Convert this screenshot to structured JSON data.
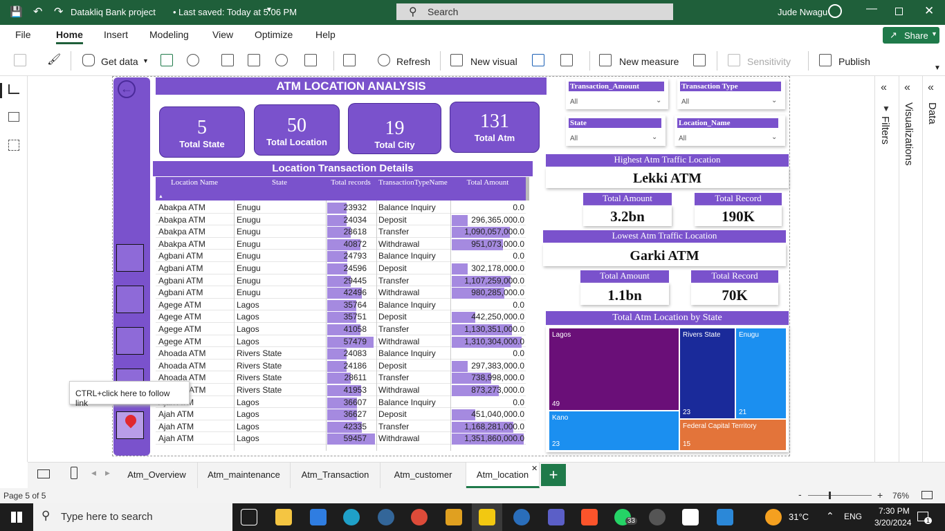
{
  "titlebar": {
    "doc_title": "Datakliq Bank project",
    "saved": "Last saved: Today at 5:06 PM",
    "search_placeholder": "Search",
    "user": "Jude Nwagu"
  },
  "menu": {
    "items": [
      "File",
      "Home",
      "Insert",
      "Modeling",
      "View",
      "Optimize",
      "Help"
    ],
    "active": "Home",
    "share": "Share"
  },
  "ribbon": {
    "get_data": "Get data",
    "refresh": "Refresh",
    "new_visual": "New visual",
    "new_measure": "New measure",
    "sensitivity": "Sensitivity",
    "publish": "Publish"
  },
  "report": {
    "title": "ATM LOCATION ANALYSIS",
    "kpis": [
      {
        "value": "5",
        "label": "Total State"
      },
      {
        "value": "50",
        "label": "Total Location"
      },
      {
        "value": "19",
        "label": "Total City"
      },
      {
        "value": "131",
        "label": "Total Atm"
      }
    ],
    "table": {
      "title": "Location Transaction Details",
      "columns": [
        "Location Name",
        "State",
        "Total records",
        "TransactionTypeName",
        "Total Amount"
      ],
      "rows": [
        [
          "Abakpa ATM",
          "Enugu",
          "23932",
          "Balance Inquiry",
          "0.0",
          0.4,
          0.0
        ],
        [
          "Abakpa ATM",
          "Enugu",
          "24034",
          "Deposit",
          "296,365,000.0",
          0.4,
          0.22
        ],
        [
          "Abakpa ATM",
          "Enugu",
          "28618",
          "Transfer",
          "1,090,057,000.0",
          0.48,
          0.81
        ],
        [
          "Abakpa ATM",
          "Enugu",
          "40872",
          "Withdrawal",
          "951,073,000.0",
          0.68,
          0.71
        ],
        [
          "Agbani ATM",
          "Enugu",
          "24793",
          "Balance Inquiry",
          "0.0",
          0.41,
          0.0
        ],
        [
          "Agbani ATM",
          "Enugu",
          "24596",
          "Deposit",
          "302,178,000.0",
          0.41,
          0.22
        ],
        [
          "Agbani ATM",
          "Enugu",
          "29445",
          "Transfer",
          "1,107,259,000.0",
          0.49,
          0.82
        ],
        [
          "Agbani ATM",
          "Enugu",
          "42496",
          "Withdrawal",
          "980,285,000.0",
          0.71,
          0.73
        ],
        [
          "Agege ATM",
          "Lagos",
          "35764",
          "Balance Inquiry",
          "0.0",
          0.6,
          0.0
        ],
        [
          "Agege ATM",
          "Lagos",
          "35751",
          "Deposit",
          "442,250,000.0",
          0.6,
          0.33
        ],
        [
          "Agege ATM",
          "Lagos",
          "41058",
          "Transfer",
          "1,130,351,000.0",
          0.69,
          0.84
        ],
        [
          "Agege ATM",
          "Lagos",
          "57479",
          "Withdrawal",
          "1,310,304,000.0",
          0.96,
          0.97
        ],
        [
          "Ahoada ATM",
          "Rivers State",
          "24083",
          "Balance Inquiry",
          "0.0",
          0.4,
          0.0
        ],
        [
          "Ahoada ATM",
          "Rivers State",
          "24186",
          "Deposit",
          "297,383,000.0",
          0.4,
          0.22
        ],
        [
          "Ahoada ATM",
          "Rivers State",
          "28611",
          "Transfer",
          "738,998,000.0",
          0.48,
          0.55
        ],
        [
          "Ahoada ATM",
          "Rivers State",
          "41953",
          "Withdrawal",
          "873,273,000.0",
          0.7,
          0.65
        ],
        [
          "Ajah ATM",
          "Lagos",
          "36607",
          "Balance Inquiry",
          "0.0",
          0.61,
          0.0
        ],
        [
          "Ajah ATM",
          "Lagos",
          "36627",
          "Deposit",
          "451,040,000.0",
          0.61,
          0.33
        ],
        [
          "Ajah ATM",
          "Lagos",
          "42335",
          "Transfer",
          "1,168,281,000.0",
          0.71,
          0.86
        ],
        [
          "Ajah ATM",
          "Lagos",
          "59457",
          "Withdrawal",
          "1,351,860,000.0",
          0.99,
          1.0
        ]
      ]
    },
    "slicers": [
      {
        "title": "Transaction_Amount",
        "value": "All"
      },
      {
        "title": "Transaction Type",
        "value": "All"
      },
      {
        "title": "State",
        "value": "All"
      },
      {
        "title": "Location_Name",
        "value": "All"
      }
    ],
    "highest": {
      "header": "Highest Atm Traffic Location",
      "name": "Lekki ATM",
      "amount_label": "Total Amount",
      "amount": "3.2bn",
      "record_label": "Total Record",
      "record": "190K"
    },
    "lowest": {
      "header": "Lowest Atm Traffic Location",
      "name": "Garki ATM",
      "amount_label": "Total Amount",
      "amount": "1.1bn",
      "record_label": "Total Record",
      "record": "70K"
    },
    "treemap": {
      "title": "Total Atm Location by State",
      "items": [
        {
          "name": "Lagos",
          "value": "49",
          "color": "#6a0f78"
        },
        {
          "name": "Rivers State",
          "value": "23",
          "color": "#1a2a9a"
        },
        {
          "name": "Enugu",
          "value": "21",
          "color": "#1b8ff0"
        },
        {
          "name": "Kano",
          "value": "23",
          "color": "#1b8ff0"
        },
        {
          "name": "Federal Capital Territory",
          "value": "15",
          "color": "#e3743a"
        }
      ]
    },
    "tooltip": "CTRL+click here to follow link"
  },
  "panes": {
    "filters": "Filters",
    "visualizations": "Visualizations",
    "data": "Data"
  },
  "pages": {
    "tabs": [
      "Atm_Overview",
      "Atm_maintenance",
      "Atm_Transaction",
      "Atm_customer",
      "Atm_location"
    ],
    "active": "Atm_location"
  },
  "status": {
    "page": "Page 5 of 5",
    "zoom": "76%"
  },
  "taskbar": {
    "search_placeholder": "Type here to search",
    "temp": "31°C",
    "lang": "ENG",
    "time": "7:30 PM",
    "date": "3/20/2024",
    "badge": "33",
    "notif": "1"
  }
}
